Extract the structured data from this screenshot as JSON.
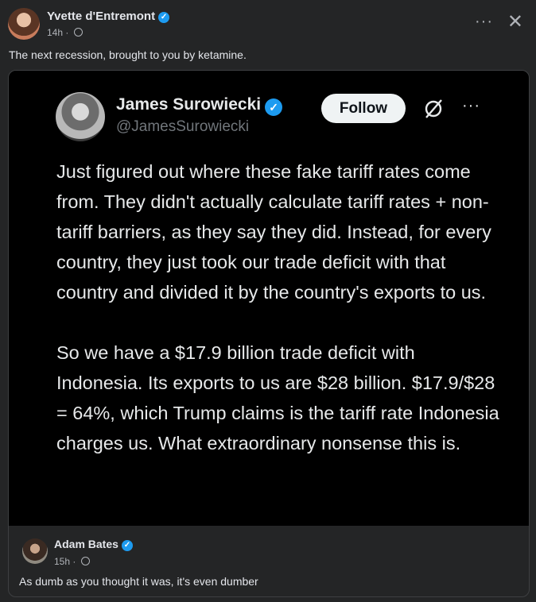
{
  "post": {
    "author": "Yvette d'Entremont",
    "time": "14h",
    "privacy_icon": "globe-icon",
    "caption": "The next recession, brought to you by ketamine."
  },
  "tweet": {
    "name": "James Surowiecki",
    "handle": "@JamesSurowiecki",
    "follow_label": "Follow",
    "paragraphs": [
      "Just figured out where these fake tariff rates come from. They didn't actually calculate tariff rates + non-tariff barriers, as they say they did. Instead, for every country, they just took our trade deficit with that country and divided it by the country's exports to us.",
      "So we have a $17.9 billion trade deficit with Indonesia. Its exports to us are $28 billion. $17.9/$28 = 64%, which Trump claims is the tariff rate Indonesia charges us. What extraordinary nonsense this is."
    ]
  },
  "comment": {
    "author": "Adam Bates",
    "time": "15h",
    "text": "As dumb as you thought it was, it's even dumber"
  },
  "colors": {
    "background": "#242526",
    "verified": "#1d9bf0",
    "tweet_background": "#000000"
  }
}
